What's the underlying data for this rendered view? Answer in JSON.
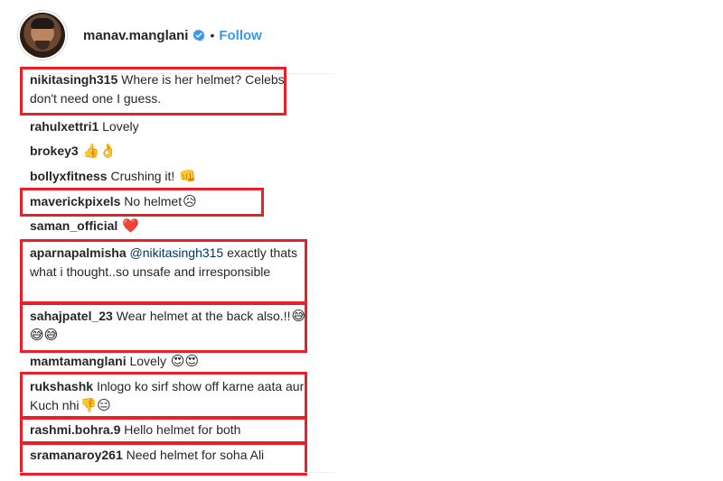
{
  "header": {
    "username": "manav.manglani",
    "separator": "•",
    "follow_label": "Follow"
  },
  "colors": {
    "highlight": "#e8202a",
    "link": "#3897f0",
    "verified": "#3897f0"
  },
  "comments": [
    {
      "user": "nikitasingh315",
      "text": "Where is her helmet? Celebs don't need one I guess.",
      "mention": "",
      "emojis": "",
      "highlighted": true
    },
    {
      "user": "rahulxettri1",
      "text": "Lovely",
      "mention": "",
      "emojis": "",
      "highlighted": false
    },
    {
      "user": "brokey3",
      "text": "",
      "mention": "",
      "emojis": "👍👌",
      "highlighted": false
    },
    {
      "user": "bollyxfitness",
      "text": "Crushing it!",
      "mention": "",
      "emojis": "👊",
      "highlighted": false
    },
    {
      "user": "maverickpixels",
      "text": "No helmet",
      "mention": "",
      "emojis": "😥",
      "highlighted": true
    },
    {
      "user": "saman_official",
      "text": "",
      "mention": "",
      "emojis": "❤️",
      "highlighted": false
    },
    {
      "user": "aparnapalmisha",
      "text": "exactly thats what i thought..so unsafe and irresponsible",
      "mention": "@nikitasingh315",
      "emojis": "",
      "highlighted": true
    },
    {
      "user": "sahajpatel_23",
      "text": "Wear helmet at the back also.!!",
      "mention": "",
      "emojis": "😅😅😅",
      "highlighted": true
    },
    {
      "user": "mamtamanglani",
      "text": "Lovely",
      "mention": "",
      "emojis": "😍😍",
      "highlighted": false
    },
    {
      "user": "rukshashk",
      "text": "Inlogo ko sirf show off karne aata aur Kuch nhi",
      "mention": "",
      "emojis": "👎😑",
      "highlighted": true
    },
    {
      "user": "rashmi.bohra.9",
      "text": "Hello helmet for both",
      "mention": "",
      "emojis": "",
      "highlighted": true
    },
    {
      "user": "sramanaroy261",
      "text": "Need helmet for soha Ali",
      "mention": "",
      "emojis": "",
      "highlighted": true
    }
  ]
}
